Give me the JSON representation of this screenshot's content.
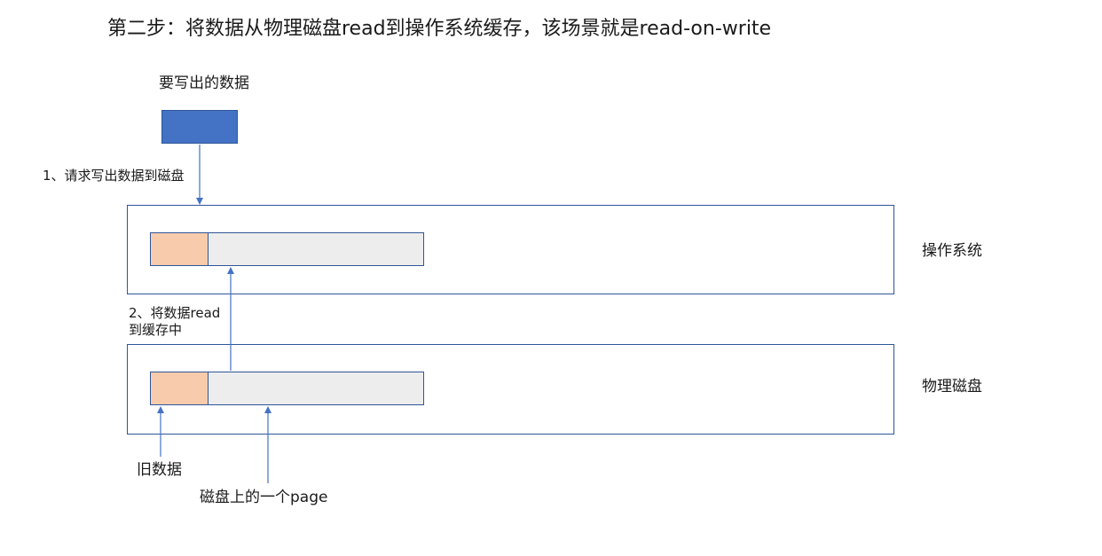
{
  "title": "第二步：将数据从物理磁盘read到操作系统缓存，该场景就是read-on-write",
  "data_to_write_label": "要写出的数据",
  "step1_label": "1、请求写出数据到磁盘",
  "step2_label_line1": "2、将数据read",
  "step2_label_line2": "到缓存中",
  "os_label": "操作系统",
  "disk_label": "物理磁盘",
  "old_data_label": "旧数据",
  "page_label": "磁盘上的一个page",
  "colors": {
    "write_block": "#4472c4",
    "old_data": "#f8cbad",
    "page": "#ededed",
    "border": "#2f5597",
    "arrow": "#4472c4"
  }
}
